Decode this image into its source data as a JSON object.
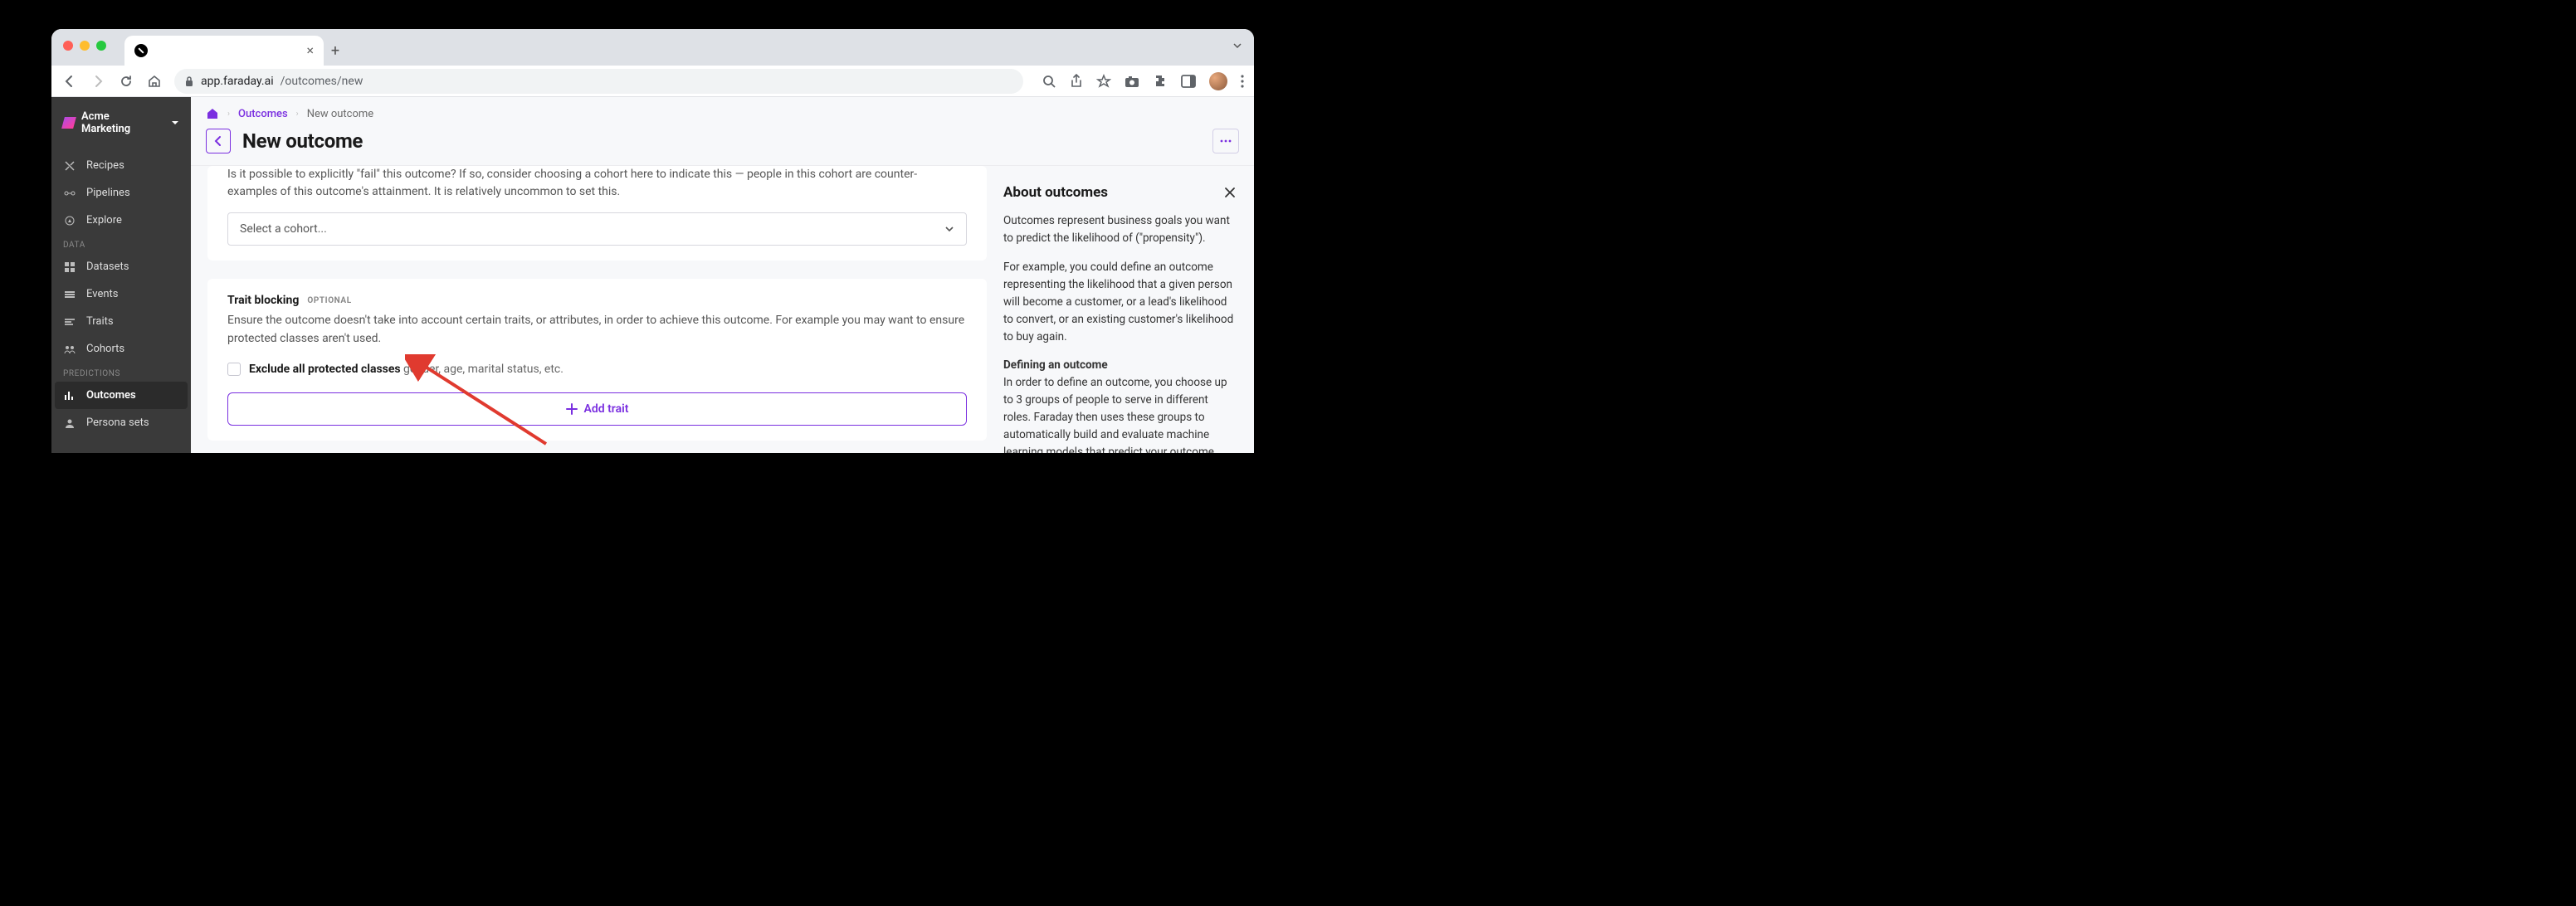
{
  "browser": {
    "url_domain": "app.faraday.ai",
    "url_path": "/outcomes/new",
    "tab_title": ""
  },
  "workspace": {
    "name": "Acme Marketing"
  },
  "sidebar": {
    "items": [
      {
        "label": "Recipes"
      },
      {
        "label": "Pipelines"
      },
      {
        "label": "Explore"
      }
    ],
    "data_header": "DATA",
    "data_items": [
      {
        "label": "Datasets"
      },
      {
        "label": "Events"
      },
      {
        "label": "Traits"
      },
      {
        "label": "Cohorts"
      }
    ],
    "predictions_header": "PREDICTIONS",
    "predictions_items": [
      {
        "label": "Outcomes",
        "active": true
      },
      {
        "label": "Persona sets"
      }
    ]
  },
  "breadcrumbs": {
    "link": "Outcomes",
    "current": "New outcome"
  },
  "header": {
    "title": "New outcome"
  },
  "cut_card": {
    "text_line1": "Is it possible to explicitly \"fail\" this outcome? If so, consider choosing a cohort here to indicate this — people in this cohort are counter-",
    "text_line2": "examples of this outcome's attainment. It is relatively uncommon to set this.",
    "select_placeholder": "Select a cohort..."
  },
  "trait_card": {
    "title": "Trait blocking",
    "optional": "OPTIONAL",
    "desc": "Ensure the outcome doesn't take into account certain traits, or attributes, in order to achieve this outcome. For example you may want to ensure protected classes aren't used.",
    "checkbox_label": "Exclude all protected classes",
    "checkbox_suffix": " gender, age, marital status, etc.",
    "add_trait": "Add trait"
  },
  "aside": {
    "title": "About outcomes",
    "p1": "Outcomes represent business goals you want to predict the likelihood of (\"propensity\").",
    "p2": "For example, you could define an outcome representing the likelihood that a given person will become a customer, or a lead's likelihood to convert, or an existing customer's likelihood to buy again.",
    "p3_title": "Defining an outcome",
    "p3": "In order to define an outcome, you choose up to 3 groups of people to serve in different roles. Faraday then uses these groups to automatically build and evaluate machine learning models that predict your outcome."
  }
}
